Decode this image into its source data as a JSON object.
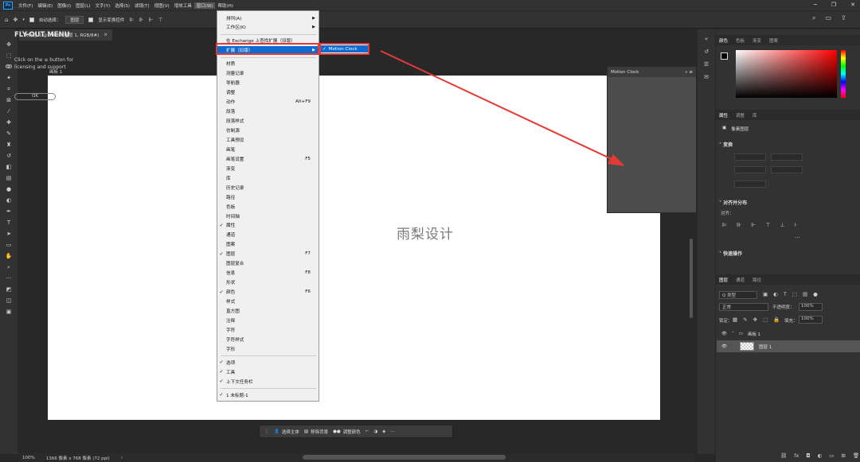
{
  "app": {
    "logo": "Ps"
  },
  "menubar": {
    "items": [
      "文件(F)",
      "编辑(E)",
      "图像(I)",
      "图层(L)",
      "文字(Y)",
      "选择(S)",
      "滤镜(T)",
      "视图(V)",
      "增效工具",
      "窗口(W)",
      "帮助(H)"
    ]
  },
  "options": {
    "auto_select_label": "自动选择：",
    "auto_select_value": "图层",
    "show_transform_label": "显示变换控件"
  },
  "document_tab": {
    "title": "未标题-1 @ 100% (图层 1, RGB/8#)",
    "close": "×"
  },
  "canvas": {
    "artboard_label": "画板 1",
    "watermark": "雨梨设计"
  },
  "window_menu": {
    "items": [
      {
        "label": "排列(A)",
        "arrow": true
      },
      {
        "label": "工作区(K)",
        "arrow": true
      },
      {
        "sep": true
      },
      {
        "label": "在 Exchange 上查找扩展（旧版）"
      },
      {
        "label": "扩展（旧版）",
        "arrow": true,
        "highlight": true
      },
      {
        "sep": true
      },
      {
        "label": "材质"
      },
      {
        "label": "测量记录"
      },
      {
        "label": "导航器"
      },
      {
        "label": "调整"
      },
      {
        "label": "动作",
        "shortcut": "Alt+F9"
      },
      {
        "label": "段落"
      },
      {
        "label": "段落样式"
      },
      {
        "label": "仿制源"
      },
      {
        "label": "工具预设"
      },
      {
        "label": "画笔"
      },
      {
        "label": "画笔设置",
        "shortcut": "F5"
      },
      {
        "label": "渐变"
      },
      {
        "label": "库"
      },
      {
        "label": "历史记录"
      },
      {
        "label": "路径"
      },
      {
        "label": "色板"
      },
      {
        "label": "时间轴"
      },
      {
        "label": "属性",
        "checked": true
      },
      {
        "label": "通道"
      },
      {
        "label": "图案"
      },
      {
        "label": "图层",
        "checked": true,
        "shortcut": "F7"
      },
      {
        "label": "图层复合"
      },
      {
        "label": "信息",
        "shortcut": "F8"
      },
      {
        "label": "形状"
      },
      {
        "label": "颜色",
        "checked": true,
        "shortcut": "F6"
      },
      {
        "label": "样式"
      },
      {
        "label": "直方图"
      },
      {
        "label": "注释"
      },
      {
        "label": "字符"
      },
      {
        "label": "字符样式"
      },
      {
        "label": "字形"
      },
      {
        "sep": true
      },
      {
        "label": "选项",
        "checked": true
      },
      {
        "label": "工具",
        "checked": true
      },
      {
        "label": "上下文任务栏",
        "checked": true
      },
      {
        "sep": true
      },
      {
        "label": "1 未标题-1",
        "checked": true
      }
    ],
    "submenu_item": "Motion Clock",
    "submenu_check": "✓"
  },
  "flyout": {
    "header": "Motion Clock",
    "header_icons": "»  ≡",
    "title": "FLY-OUT MENU",
    "text": "Click on the ≡ button for licensing and support",
    "ok": "OK"
  },
  "context_bar": {
    "select_subject": "选择主体",
    "remove_bg": "移除背景",
    "adjust_color": "调整颜色"
  },
  "status": {
    "zoom": "100%",
    "doc": "1366 像素 x 768 像素 (72 ppi)"
  },
  "panels": {
    "color_tabs": [
      "颜色",
      "色板",
      "渐变",
      "图案"
    ],
    "props_tabs": [
      "属性",
      "调整",
      "库"
    ],
    "layer_label": "像素图层",
    "transform": "变换",
    "align": "对齐并分布",
    "align_label": "对齐：",
    "quick": "快速操作",
    "layers_tabs": [
      "图层",
      "通道",
      "路径"
    ],
    "kind": "Q 类型",
    "blend": "正常",
    "opacity_label": "不透明度：",
    "opacity": "100%",
    "lock_label": "锁定：",
    "fill_label": "填充：",
    "fill": "100%",
    "layers": [
      {
        "name": "画板 1"
      },
      {
        "name": "图层 1"
      }
    ]
  },
  "colors": {
    "accent": "#0d6ad1",
    "highlight_box": "#e53935"
  }
}
